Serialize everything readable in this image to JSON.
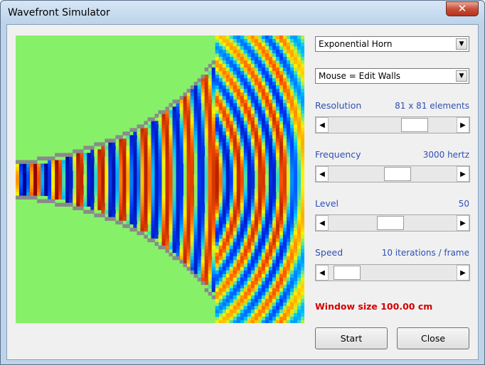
{
  "window": {
    "title": "Wavefront Simulator",
    "close_glyph": "✕"
  },
  "controls": {
    "shape_select": {
      "value": "Exponential Horn"
    },
    "mouse_select": {
      "value": "Mouse = Edit Walls"
    },
    "resolution": {
      "label": "Resolution",
      "value": "81 x 81 elements",
      "position": 0.72
    },
    "frequency": {
      "label": "Frequency",
      "value": "3000 hertz",
      "position": 0.55
    },
    "level": {
      "label": "Level",
      "value": "50",
      "position": 0.48
    },
    "speed": {
      "label": "Speed",
      "value": "10 iterations / frame",
      "position": 0.05
    },
    "window_size": "Window size 100.00 cm"
  },
  "buttons": {
    "start": "Start",
    "close": "Close"
  },
  "icons": {
    "left": "◀",
    "right": "▶",
    "down": "▼"
  },
  "colors": {
    "field": "#86f069",
    "wall": "#8a8a8a",
    "warn": "#d40000",
    "label": "#2e4fb5"
  }
}
